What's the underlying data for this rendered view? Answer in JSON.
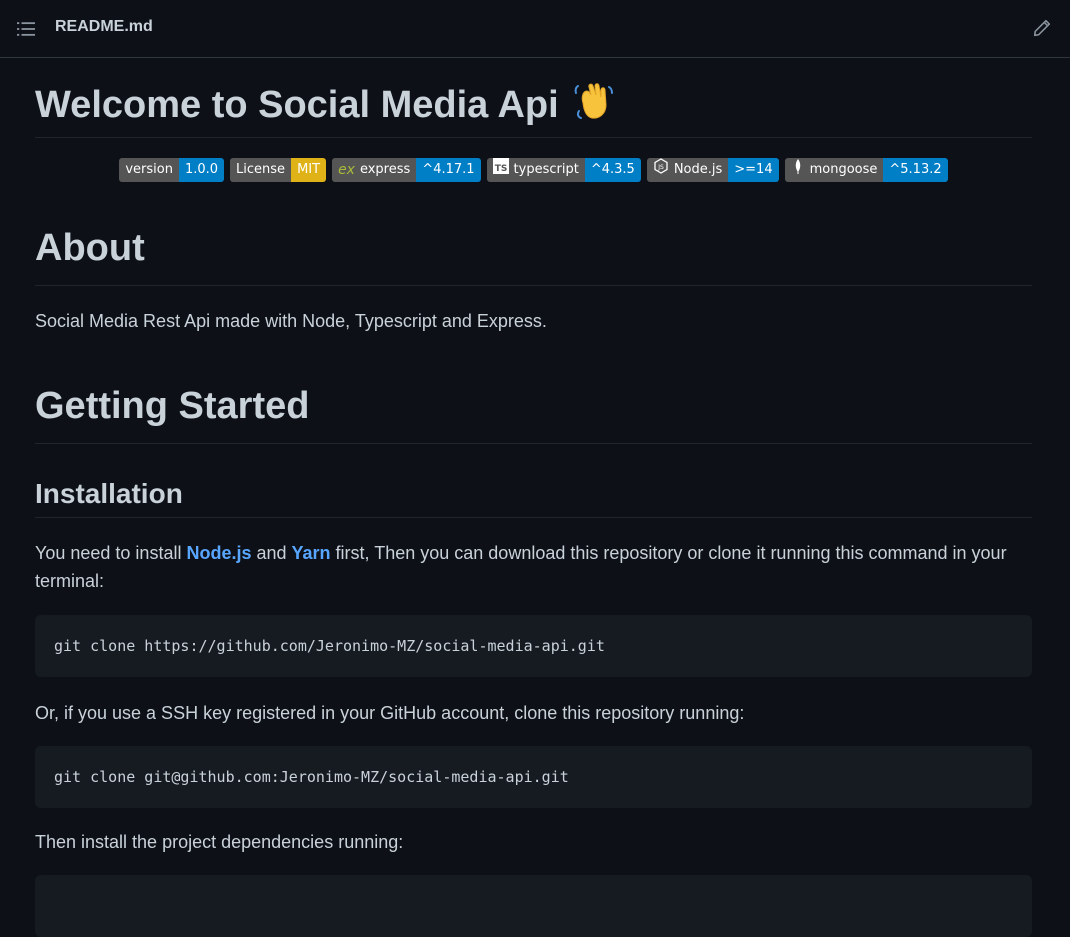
{
  "header": {
    "file_name": "README.md"
  },
  "readme": {
    "title": "Welcome to Social Media Api",
    "badges": [
      {
        "label": "version",
        "value": "1.0.0",
        "color": "#007ec6"
      },
      {
        "label": "License",
        "value": "MIT",
        "color": "#dfb317"
      },
      {
        "label": "express",
        "value": "^4.17.1",
        "color": "#007ec6"
      },
      {
        "label": "typescript",
        "value": "^4.3.5",
        "color": "#007ec6"
      },
      {
        "label": "Node.js",
        "value": ">=14",
        "color": "#007ec6"
      },
      {
        "label": "mongoose",
        "value": "^5.13.2",
        "color": "#007ec6"
      }
    ],
    "about_heading": "About",
    "about_text": "Social Media Rest Api made with Node, Typescript and Express.",
    "getting_started_heading": "Getting Started",
    "installation_heading": "Installation",
    "install_text_1": "You need to install ",
    "install_link_node": "Node.js",
    "install_text_2": " and ",
    "install_link_yarn": "Yarn",
    "install_text_3": " first, Then you can download this repository or clone it running this command in your terminal:",
    "code_https": "git clone https://github.com/Jeronimo-MZ/social-media-api.git",
    "ssh_text": "Or, if you use a SSH key registered in your GitHub account, clone this repository running:",
    "code_ssh": "git clone git@github.com:Jeronimo-MZ/social-media-api.git",
    "deps_text": "Then install the project dependencies running:"
  },
  "colors": {
    "background": "#0d1117",
    "text": "#c9d1d9",
    "link": "#58a6ff",
    "code_bg": "#161b22"
  }
}
